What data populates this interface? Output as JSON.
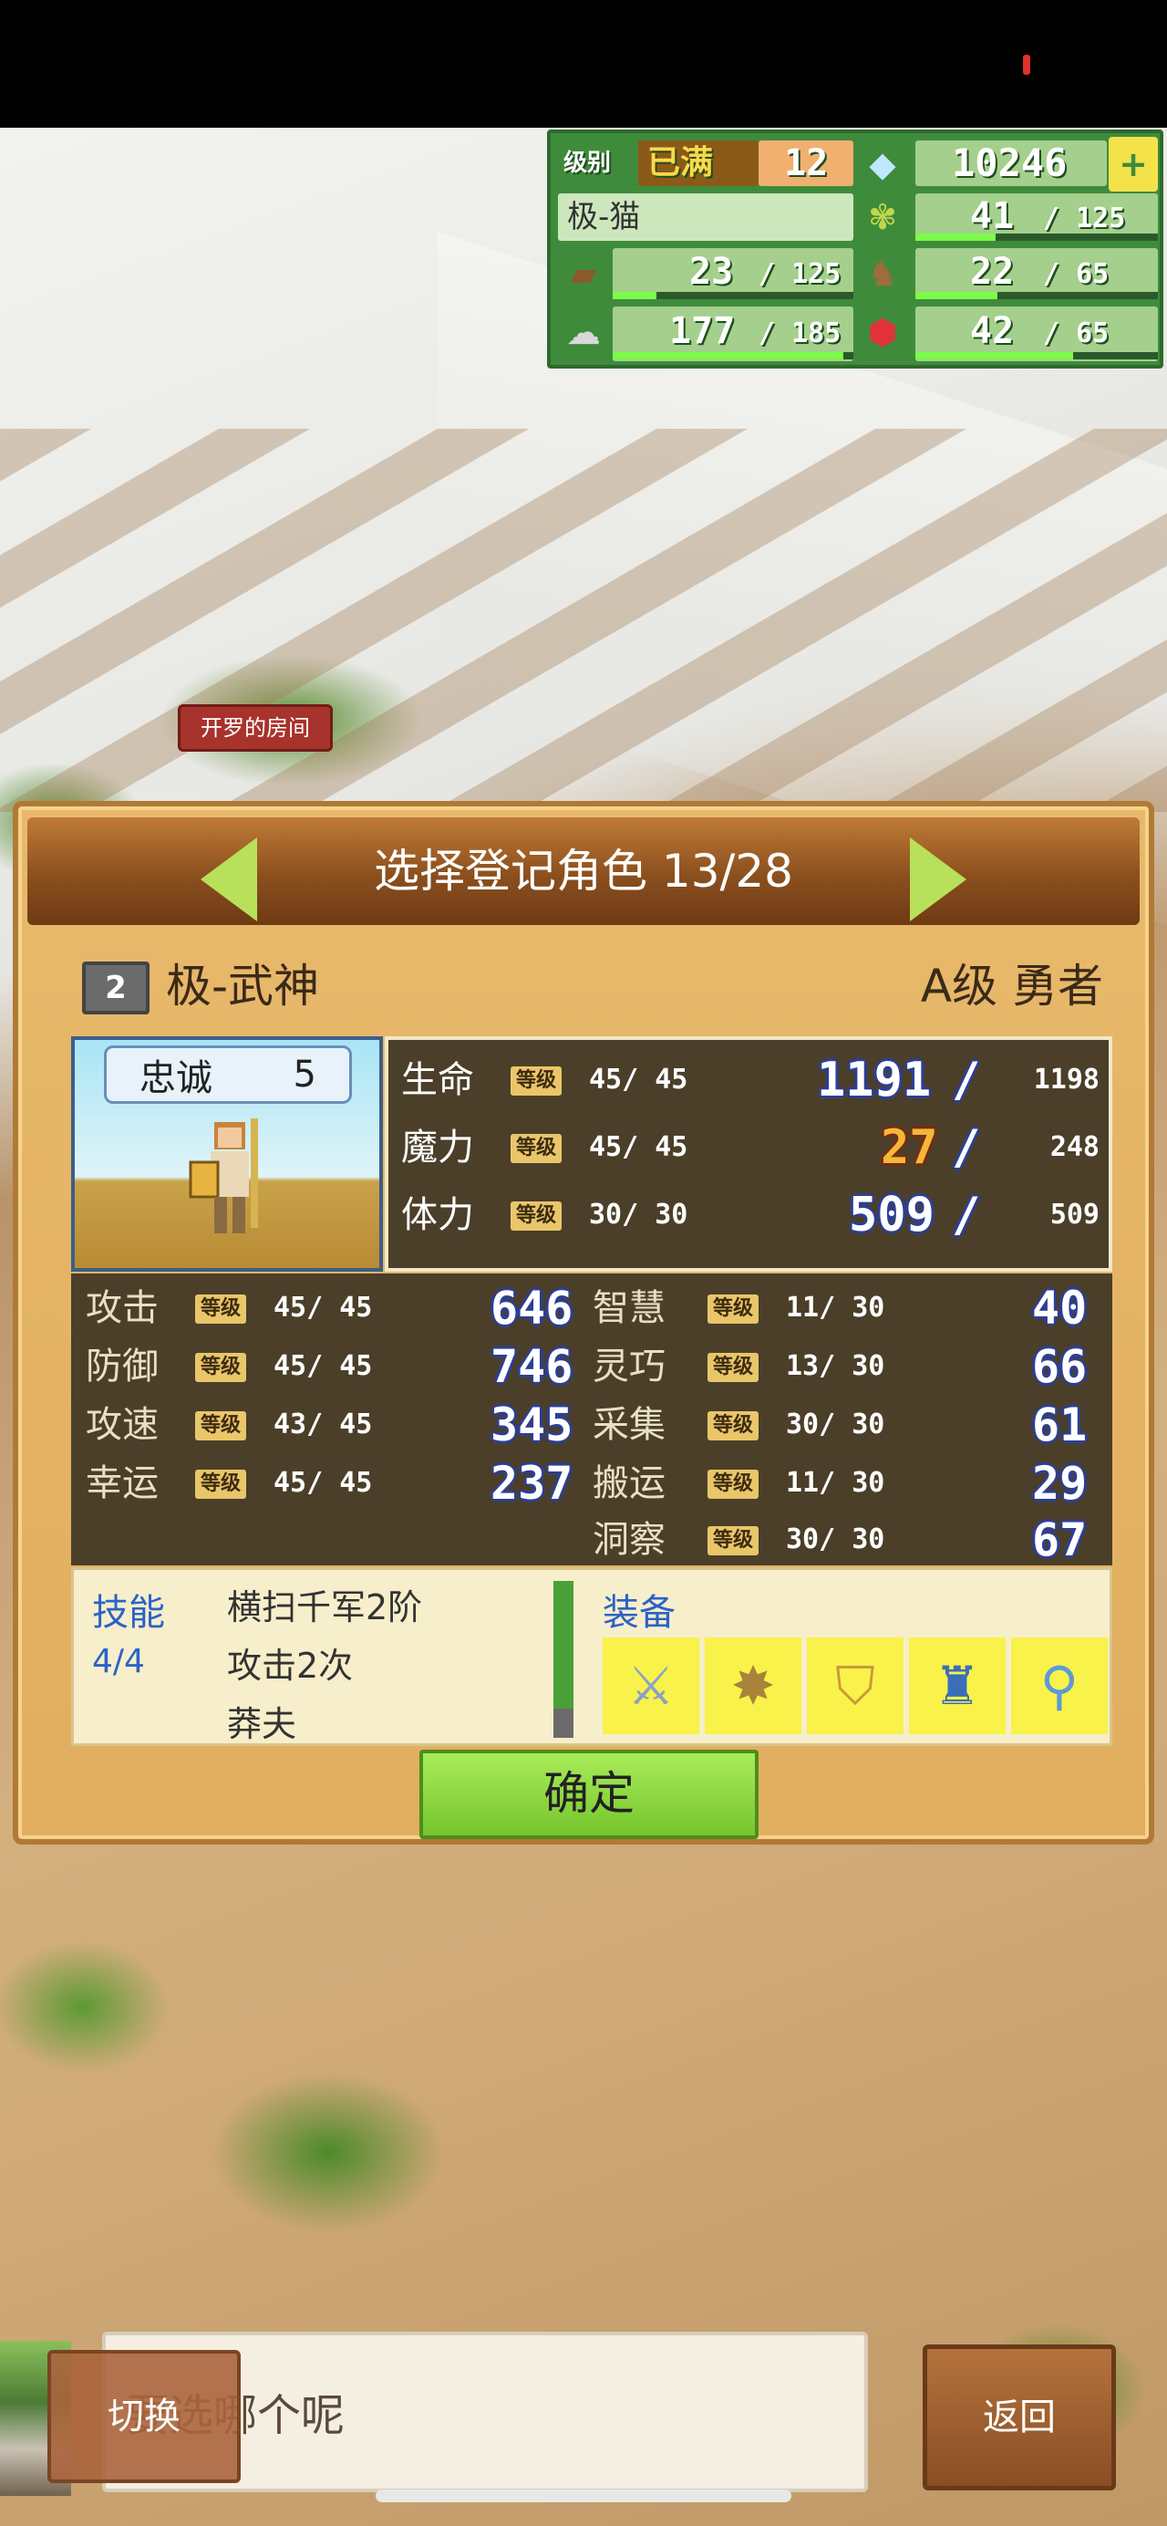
{
  "hud": {
    "rank_label": "级别",
    "rank_status": "已满",
    "rank_value": "12",
    "gems": "10246",
    "name": "极-猫",
    "grain": "41",
    "grain_max": "125",
    "wood": "23",
    "wood_max": "125",
    "food": "22",
    "food_max": "65",
    "ore": "177",
    "ore_max": "185",
    "crystal": "42",
    "crystal_max": "65",
    "levels": {
      "grain": 0.33,
      "wood": 0.18,
      "food": 0.34,
      "ore": 0.96,
      "crystal": 0.65
    }
  },
  "map": {
    "room_label": "开罗的房间"
  },
  "panel": {
    "title": "选择登记角色 13/28",
    "rank_badge": "2",
    "character_name": "极-武神",
    "character_class": "A级 勇者",
    "loyalty_label": "忠诚",
    "loyalty_value": "5",
    "level_tag": "等级",
    "slash": "/",
    "vitals": [
      {
        "label": "生命",
        "lvl": "45",
        "lvl_max": "45",
        "value": "1191",
        "max": "1198"
      },
      {
        "label": "魔力",
        "lvl": "45",
        "lvl_max": "45",
        "value": "27",
        "max": "248"
      },
      {
        "label": "体力",
        "lvl": "30",
        "lvl_max": "30",
        "value": "509",
        "max": "509"
      }
    ],
    "stats_left": [
      {
        "label": "攻击",
        "lvl": "45",
        "lvl_max": "45",
        "value": "646"
      },
      {
        "label": "防御",
        "lvl": "45",
        "lvl_max": "45",
        "value": "746"
      },
      {
        "label": "攻速",
        "lvl": "43",
        "lvl_max": "45",
        "value": "345"
      },
      {
        "label": "幸运",
        "lvl": "45",
        "lvl_max": "45",
        "value": "237"
      }
    ],
    "stats_right": [
      {
        "label": "智慧",
        "lvl": "11",
        "lvl_max": "30",
        "value": "40"
      },
      {
        "label": "灵巧",
        "lvl": "13",
        "lvl_max": "30",
        "value": "66"
      },
      {
        "label": "采集",
        "lvl": "30",
        "lvl_max": "30",
        "value": "61"
      },
      {
        "label": "搬运",
        "lvl": "11",
        "lvl_max": "30",
        "value": "29"
      },
      {
        "label": "洞察",
        "lvl": "30",
        "lvl_max": "30",
        "value": "67"
      }
    ],
    "skills_label": "技能",
    "skills_count": "4/4",
    "skills": [
      "横扫千军2阶",
      "攻击2次",
      "莽夫"
    ],
    "equip_label": "装备",
    "equipment_icons": [
      "sword-icon",
      "staff-icon",
      "shield-icon",
      "armor-icon",
      "ring-icon"
    ],
    "confirm_label": "确定"
  },
  "bottom": {
    "dialog_text": "要选哪个呢",
    "switch_label": "切换",
    "back_label": "返回"
  },
  "colors": {
    "hud_green": "#3f8b3c",
    "panel_bg": "#e1ae5f",
    "stat_bg": "#4b3f2a",
    "accent_blue": "#2b62c8",
    "confirm_green": "#76c52e"
  }
}
